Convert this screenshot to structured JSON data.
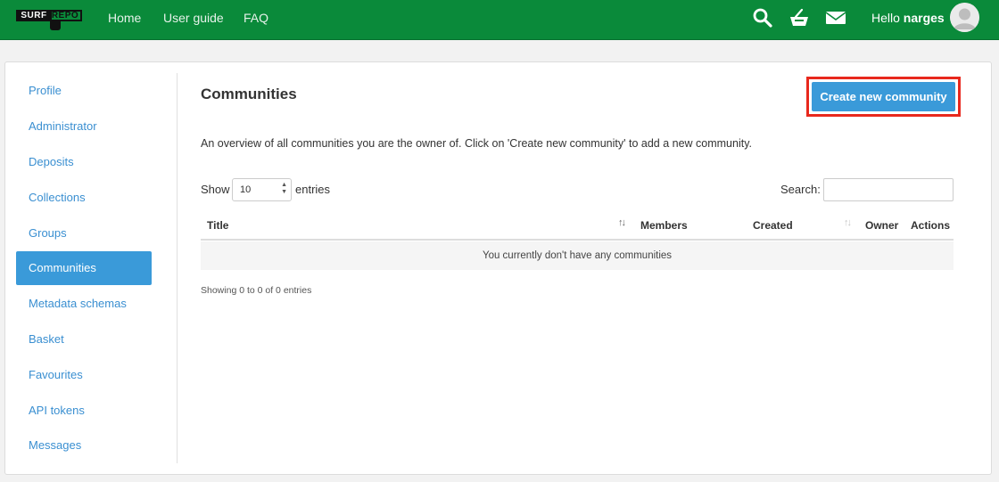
{
  "navbar": {
    "logo_left": "SURF",
    "logo_right": "REPO",
    "links": [
      "Home",
      "User guide",
      "FAQ"
    ],
    "icons": [
      "search-icon",
      "basket-icon",
      "mail-icon"
    ],
    "greeting": "Hello",
    "username": "narges",
    "color": "#0a8a3a"
  },
  "sidebar": {
    "items": [
      {
        "label": "Profile"
      },
      {
        "label": "Administrator"
      },
      {
        "label": "Deposits"
      },
      {
        "label": "Collections"
      },
      {
        "label": "Groups"
      },
      {
        "label": "Communities",
        "active": true
      },
      {
        "label": "Metadata schemas"
      },
      {
        "label": "Basket"
      },
      {
        "label": "Favourites"
      },
      {
        "label": "API tokens"
      },
      {
        "label": "Messages"
      }
    ],
    "active_color": "#3a9ad9"
  },
  "main": {
    "title": "Communities",
    "create_button": "Create new community",
    "description": "An overview of all communities you are the owner of. Click on 'Create new community' to add a new community.",
    "show_label": "Show",
    "entries_value": "10",
    "entries_label": "entries",
    "search_label": "Search:",
    "search_value": "",
    "columns": [
      "Title",
      "Members",
      "Created",
      "Owner",
      "Actions"
    ],
    "empty_message": "You currently don't have any communities",
    "info": "Showing 0 to 0 of 0 entries",
    "highlight_color": "#e8281d"
  }
}
